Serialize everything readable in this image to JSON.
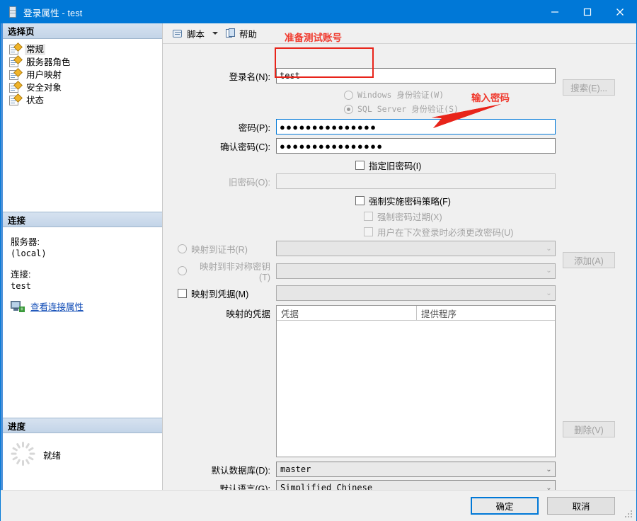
{
  "window": {
    "title": "登录属性 - test",
    "icon": "login-properties-icon",
    "minimize": "—",
    "maximize": "□",
    "close": "✕"
  },
  "sidebar": {
    "pages_header": "选择页",
    "items": [
      {
        "label": "常规",
        "icon": "page-icon",
        "selected": true
      },
      {
        "label": "服务器角色",
        "icon": "page-icon",
        "selected": false
      },
      {
        "label": "用户映射",
        "icon": "page-icon",
        "selected": false
      },
      {
        "label": "安全对象",
        "icon": "page-icon",
        "selected": false
      },
      {
        "label": "状态",
        "icon": "page-icon",
        "selected": false
      }
    ],
    "connection_header": "连接",
    "server_label": "服务器:",
    "server_value": "(local)",
    "connection_label": "连接:",
    "connection_value": "test",
    "view_connection_link": "查看连接属性",
    "connection_icon": "server-connection-icon",
    "progress_header": "进度",
    "progress_status": "就绪",
    "progress_icon": "spinner-icon"
  },
  "toolbar": {
    "script_label": "脚本",
    "script_icon": "script-scroll-icon",
    "script_dropdown_icon": "chevron-down-icon",
    "help_label": "帮助",
    "help_icon": "help-pages-icon"
  },
  "form": {
    "login_name_label": "登录名(N):",
    "login_name_value": "test",
    "search_button": "搜索(E)...",
    "windows_auth_label": "Windows 身份验证(W)",
    "sql_auth_label": "SQL Server 身份验证(S)",
    "auth_selected": "sql",
    "password_label": "密码(P):",
    "password_value": "●●●●●●●●●●●●●●●",
    "confirm_password_label": "确认密码(C):",
    "confirm_password_value": "●●●●●●●●●●●●●●●●",
    "specify_old_password_label": "指定旧密码(I)",
    "old_password_label": "旧密码(O):",
    "old_password_value": "",
    "enforce_policy_label": "强制实施密码策略(F)",
    "enforce_expiration_label": "强制密码过期(X)",
    "must_change_label": "用户在下次登录时必须更改密码(U)",
    "map_certificate_label": "映射到证书(R)",
    "map_certificate_value": "",
    "map_asymmetric_label": "映射到非对称密钥(T)",
    "map_asymmetric_value": "",
    "map_credential_label": "映射到凭据(M)",
    "map_credential_value": "",
    "add_button": "添加(A)",
    "mapped_credentials_label": "映射的凭据",
    "grid_columns": [
      "凭据",
      "提供程序"
    ],
    "grid_rows": [],
    "remove_button": "删除(V)",
    "default_database_label": "默认数据库(D):",
    "default_database_value": "master",
    "default_language_label": "默认语言(G):",
    "default_language_value": "Simplified Chinese",
    "dropdown_icon": "chevron-down-icon"
  },
  "annotations": [
    {
      "text": "准备测试账号",
      "color": "#f03a2e",
      "target": "login-name-field"
    },
    {
      "text": "输入密码",
      "color": "#f03a2e",
      "target": "password-field"
    }
  ],
  "footer": {
    "ok_button": "确定",
    "cancel_button": "取消"
  },
  "colors": {
    "titlebar": "#0078d7",
    "accent": "#0078d7",
    "annotation": "#f03a2e",
    "link": "#0b48b5"
  }
}
